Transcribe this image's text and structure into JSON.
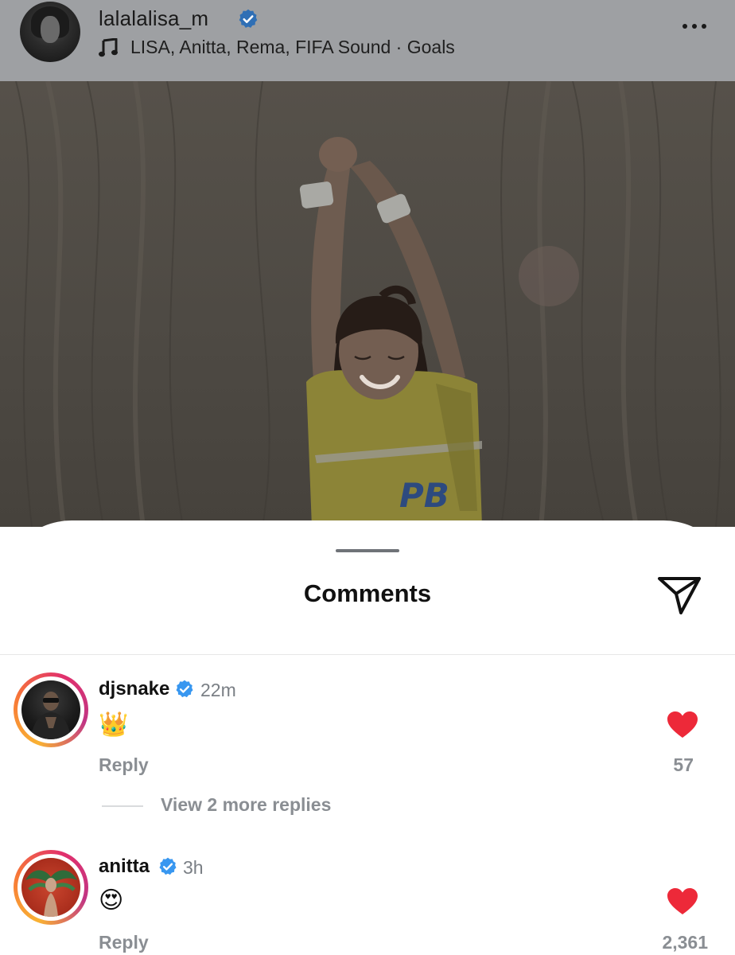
{
  "post_header": {
    "username": "lalalalisa_m",
    "music": "LISA, Anitta, Rema, FIFA Sound · Goals",
    "more_icon": "more-horizontal-icon"
  },
  "photo": {
    "jersey_text": "PB"
  },
  "sheet": {
    "title": "Comments",
    "send_icon": "send-icon"
  },
  "comments": [
    {
      "username": "djsnake",
      "verified": true,
      "time": "22m",
      "text": "👑",
      "reply_label": "Reply",
      "likes": "57"
    },
    {
      "username": "anitta",
      "verified": true,
      "time": "3h",
      "text": "😍",
      "reply_label": "Reply",
      "likes": "2,361"
    }
  ],
  "more_replies": "View 2 more replies",
  "colors": {
    "verified": "#3897f0",
    "heart": "#ed2939",
    "secondary_text": "#8a8e93"
  }
}
